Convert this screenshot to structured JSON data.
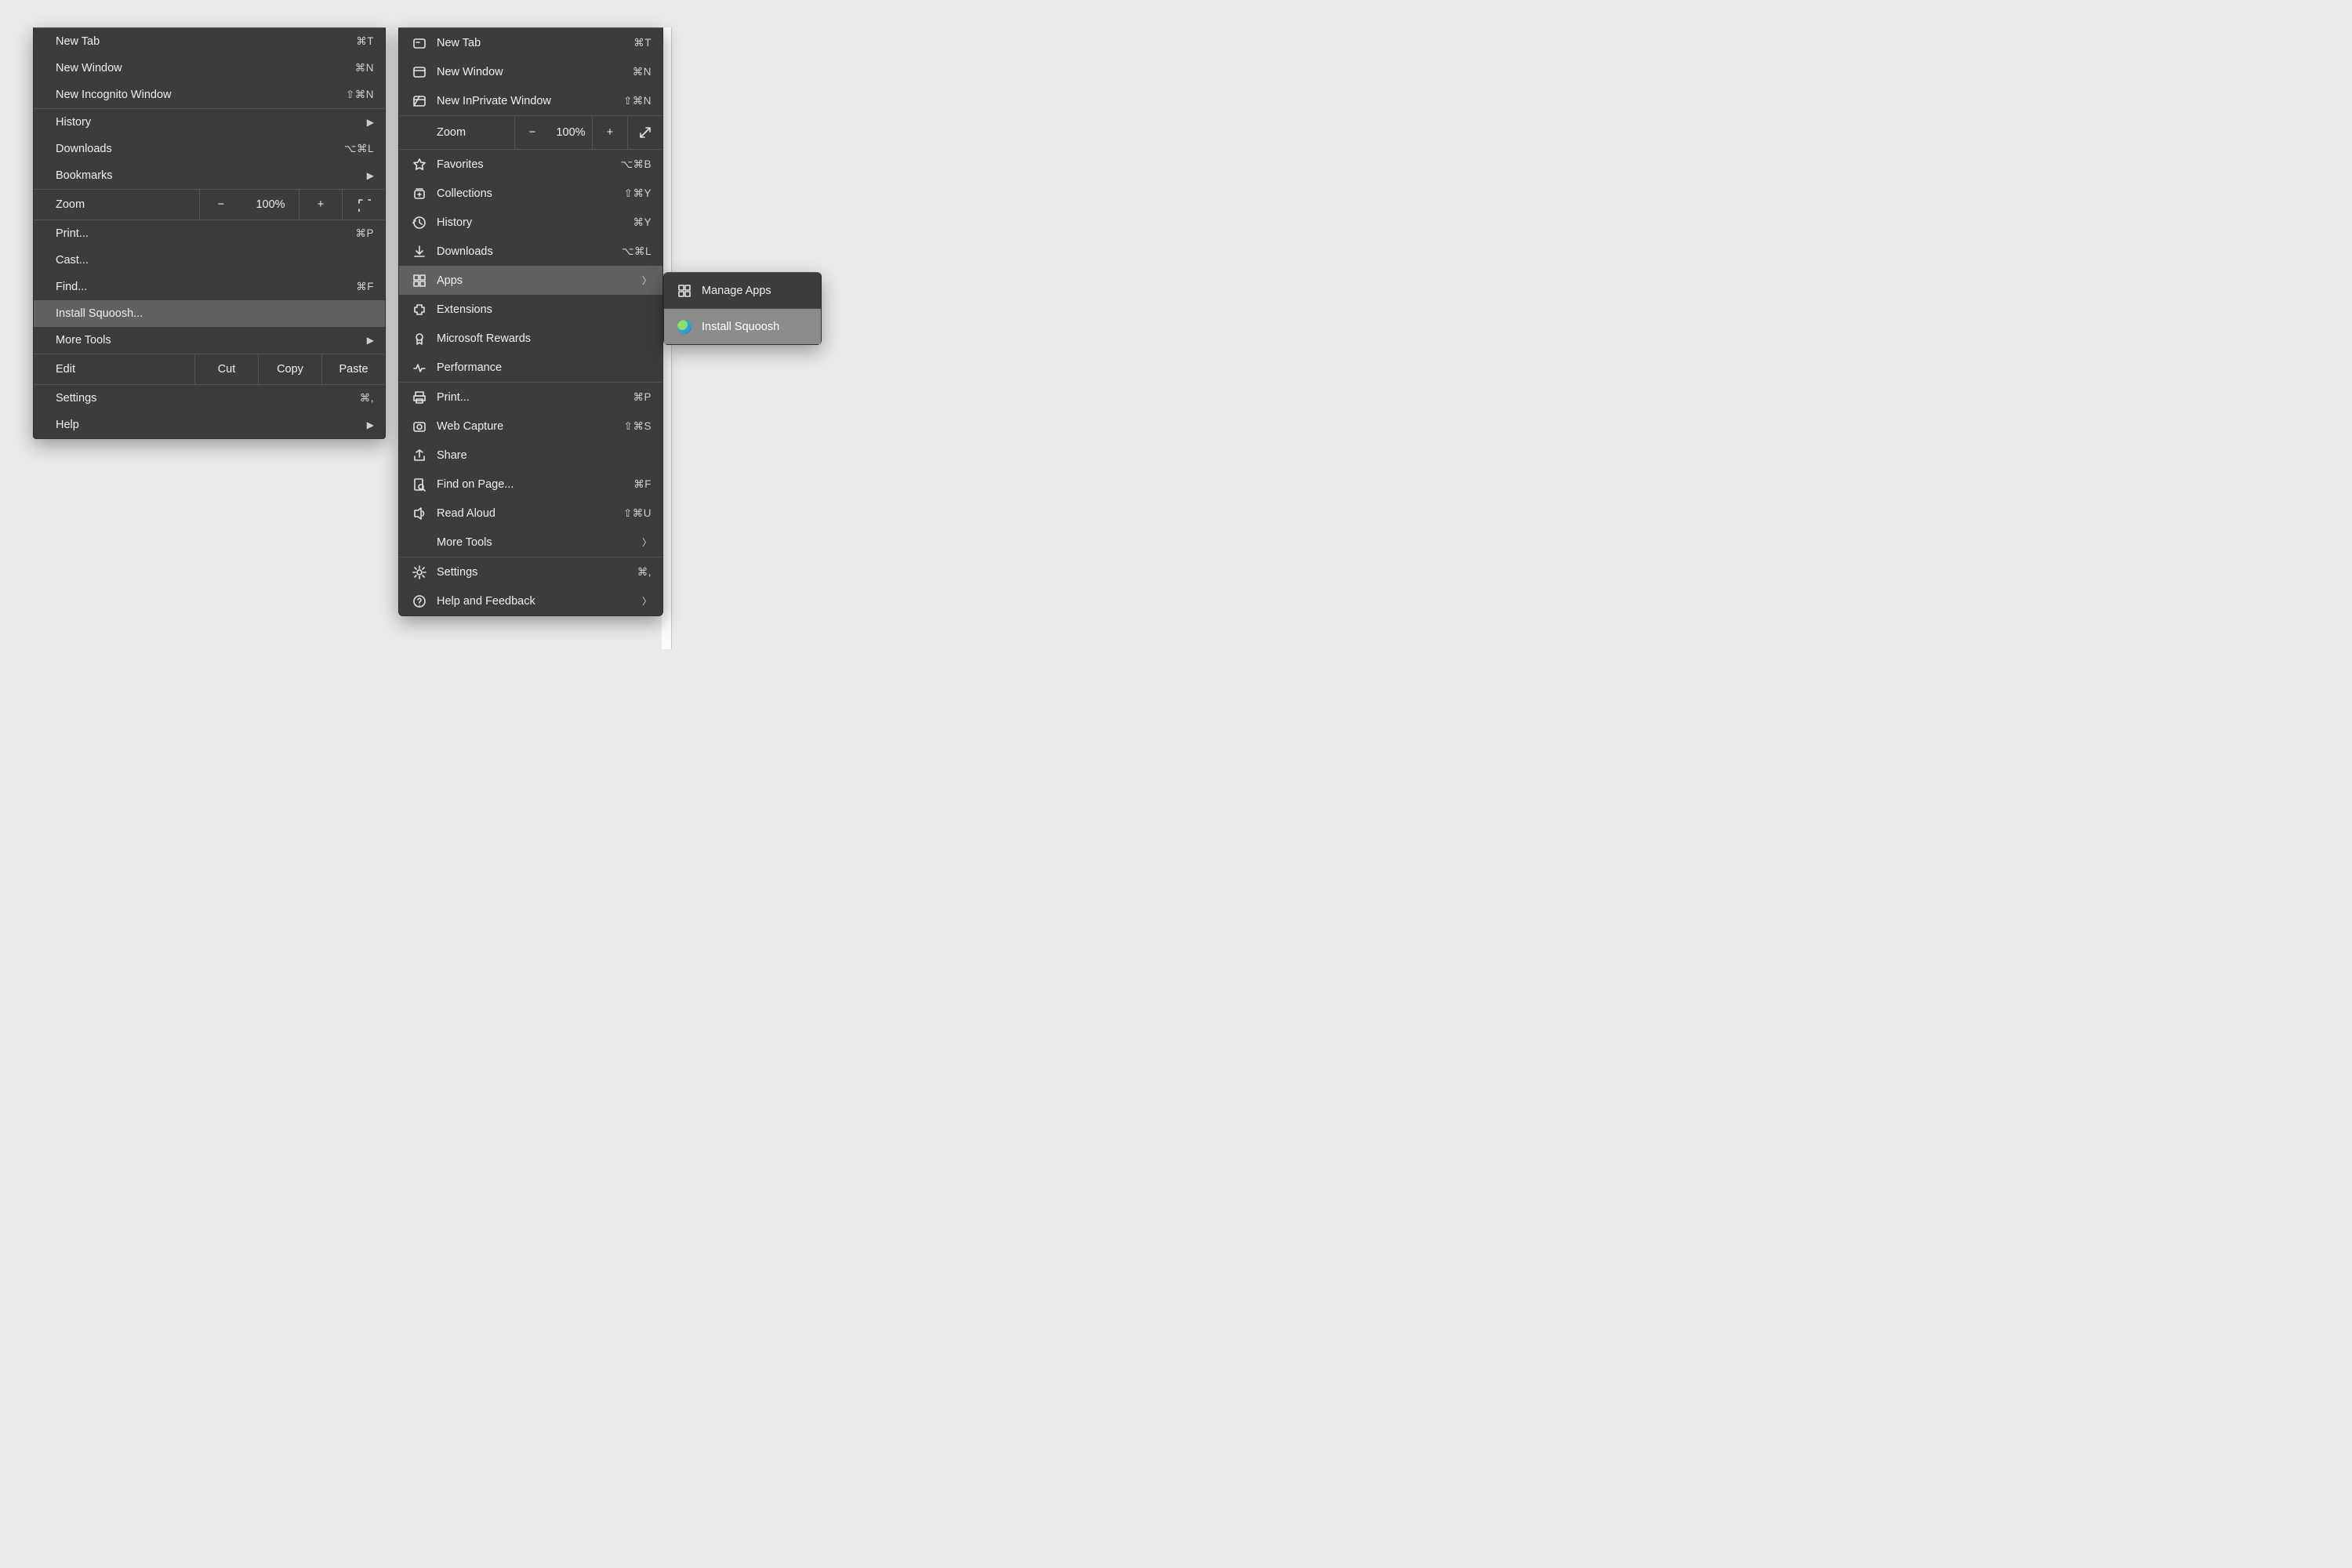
{
  "chrome": {
    "newTab": {
      "label": "New Tab",
      "sc": "⌘T"
    },
    "newWindow": {
      "label": "New Window",
      "sc": "⌘N"
    },
    "incognito": {
      "label": "New Incognito Window",
      "sc": "⇧⌘N"
    },
    "history": {
      "label": "History"
    },
    "downloads": {
      "label": "Downloads",
      "sc": "⌥⌘L"
    },
    "bookmarks": {
      "label": "Bookmarks"
    },
    "zoom": {
      "label": "Zoom",
      "value": "100%"
    },
    "print": {
      "label": "Print...",
      "sc": "⌘P"
    },
    "cast": {
      "label": "Cast..."
    },
    "find": {
      "label": "Find...",
      "sc": "⌘F"
    },
    "install": {
      "label": "Install Squoosh..."
    },
    "moreTools": {
      "label": "More Tools"
    },
    "edit": {
      "label": "Edit",
      "cut": "Cut",
      "copy": "Copy",
      "paste": "Paste"
    },
    "settings": {
      "label": "Settings",
      "sc": "⌘,"
    },
    "help": {
      "label": "Help"
    }
  },
  "edge": {
    "newTab": {
      "label": "New Tab",
      "sc": "⌘T"
    },
    "newWindow": {
      "label": "New Window",
      "sc": "⌘N"
    },
    "inprivate": {
      "label": "New InPrivate Window",
      "sc": "⇧⌘N"
    },
    "zoom": {
      "label": "Zoom",
      "value": "100%"
    },
    "favorites": {
      "label": "Favorites",
      "sc": "⌥⌘B"
    },
    "collections": {
      "label": "Collections",
      "sc": "⇧⌘Y"
    },
    "history": {
      "label": "History",
      "sc": "⌘Y"
    },
    "downloads": {
      "label": "Downloads",
      "sc": "⌥⌘L"
    },
    "apps": {
      "label": "Apps"
    },
    "extensions": {
      "label": "Extensions"
    },
    "rewards": {
      "label": "Microsoft Rewards"
    },
    "performance": {
      "label": "Performance"
    },
    "print": {
      "label": "Print...",
      "sc": "⌘P"
    },
    "capture": {
      "label": "Web Capture",
      "sc": "⇧⌘S"
    },
    "share": {
      "label": "Share"
    },
    "findOnPage": {
      "label": "Find on Page...",
      "sc": "⌘F"
    },
    "readAloud": {
      "label": "Read Aloud",
      "sc": "⇧⌘U"
    },
    "moreTools": {
      "label": "More Tools"
    },
    "settings": {
      "label": "Settings",
      "sc": "⌘,"
    },
    "help": {
      "label": "Help and Feedback"
    }
  },
  "edgeApps": {
    "manage": {
      "label": "Manage Apps"
    },
    "install": {
      "label": "Install Squoosh"
    }
  }
}
